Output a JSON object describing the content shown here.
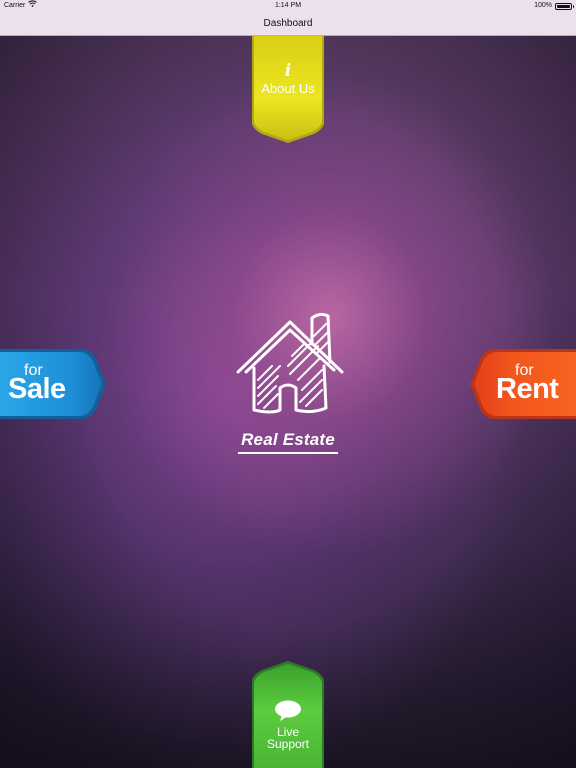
{
  "status_bar": {
    "carrier": "Carrier",
    "time": "1:14 PM",
    "battery": "100%",
    "battery_level": 1.0,
    "wifi_icon": "wifi-icon",
    "battery_icon": "battery-icon"
  },
  "nav_bar": {
    "title": "Dashboard"
  },
  "logo": {
    "text": "Real Estate",
    "icon": "house-icon"
  },
  "about": {
    "icon_glyph": "i",
    "label": "About Us",
    "icon": "info-icon",
    "color": "#e8e020"
  },
  "sale": {
    "for_label": "for",
    "main_label": "Sale",
    "color": "#1e90d8"
  },
  "rent": {
    "for_label": "for",
    "main_label": "Rent",
    "color": "#f45a1e"
  },
  "support": {
    "label_line1": "Live",
    "label_line2": "Support",
    "icon": "chat-bubble-icon",
    "color": "#52c43a"
  }
}
